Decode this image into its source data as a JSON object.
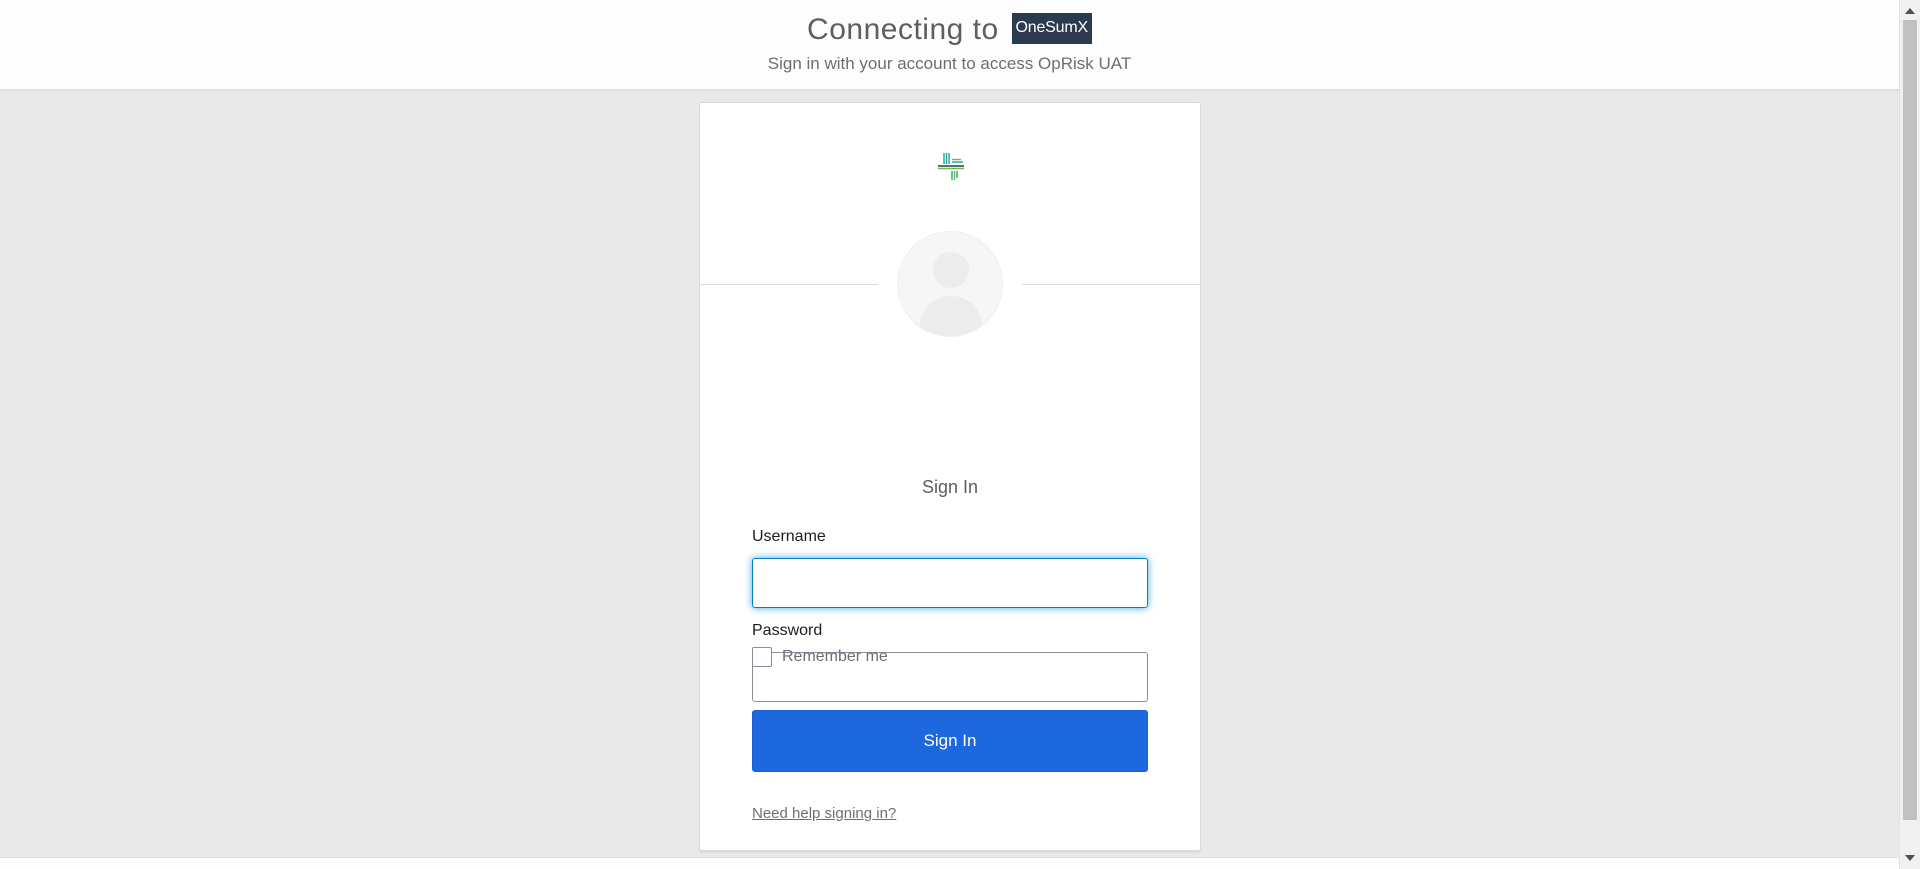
{
  "banner": {
    "connecting_text": "Connecting to",
    "brand": "OneSumX",
    "subtitle": "Sign in with your account to access OpRisk UAT"
  },
  "form": {
    "title": "Sign In",
    "username_label": "Username",
    "username_value": "",
    "password_label": "Password",
    "password_value": "",
    "remember_label": "Remember me",
    "remember_checked": false,
    "submit_label": "Sign In",
    "help_link": "Need help signing in?"
  },
  "icons": {
    "logo": "org-logo-icon",
    "avatar": "user-avatar-icon",
    "scroll_up": "scroll-up-icon",
    "scroll_down": "scroll-down-icon"
  },
  "colors": {
    "page_bg": "#e9e9ea",
    "brand_chip_bg": "#2b3a4e",
    "primary_button": "#1d67df",
    "focus_ring": "#0091d4",
    "logo_teal": "#1aa59a",
    "logo_green": "#6cbf3a",
    "logo_navy": "#1f3a5f"
  }
}
